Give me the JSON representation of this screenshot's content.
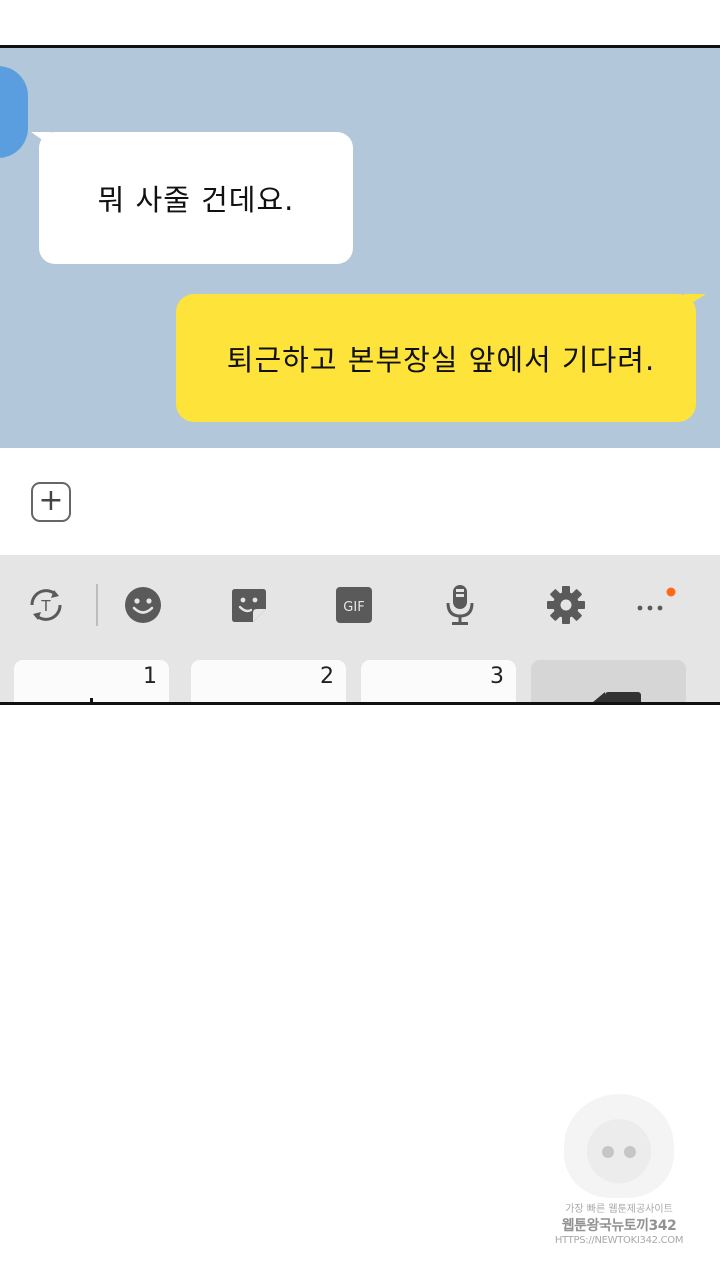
{
  "chat": {
    "received_message": "뭐 사줄 건데요.",
    "sent_message": "퇴근하고 본부장실 앞에서 기다려."
  },
  "input": {
    "plus_label": "+"
  },
  "keyboard": {
    "toolbar": {
      "icons": [
        "text-toggle-icon",
        "emoji-icon",
        "sticker-icon",
        "gif-icon",
        "microphone-icon",
        "gear-icon",
        "more-icon"
      ],
      "gif_label": "GIF"
    },
    "keys": [
      {
        "number": "1"
      },
      {
        "number": "2"
      },
      {
        "number": "3"
      }
    ]
  },
  "colors": {
    "chat_background": "#b2c7d9",
    "sent_bubble": "#fee33a",
    "received_bubble": "#ffffff",
    "keyboard_background": "#e5e5e5",
    "notification_dot": "#ff6a1a"
  },
  "watermark": {
    "line1": "가장 빠른 웹툰제공사이트",
    "line2": "웹툰왕국뉴토끼342",
    "line3": "HTTPS://NEWTOKI342.COM"
  }
}
